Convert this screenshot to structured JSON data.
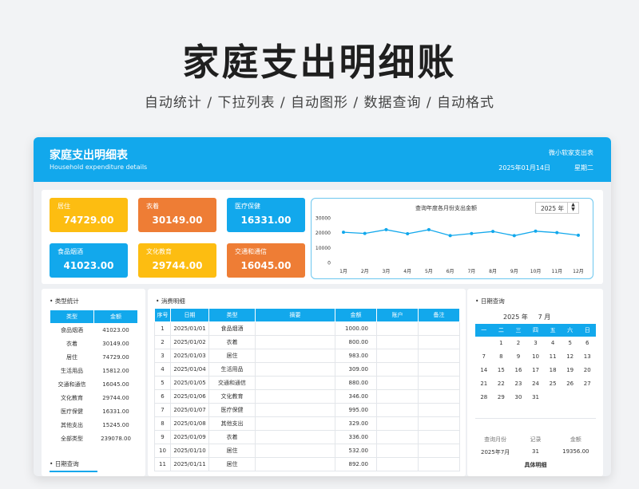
{
  "hero": {
    "title": "家庭支出明细账",
    "subtitle": "自动统计 / 下拉列表 / 自动图形 / 数据查询 / 自动格式"
  },
  "header": {
    "title": "家庭支出明细表",
    "subtitle": "Household expenditure details",
    "brand": "微小软家支出表",
    "date": "2025年01月14日",
    "weekday": "星期二"
  },
  "colors": {
    "accent": "#12a8ec",
    "yellow": "#fdbd11",
    "orange": "#ee7d35",
    "blue": "#12a8ec"
  },
  "cards": [
    {
      "label": "居住",
      "value": "74729.00",
      "color": "#fdbd11"
    },
    {
      "label": "衣着",
      "value": "30149.00",
      "color": "#ee7d35"
    },
    {
      "label": "医疗保健",
      "value": "16331.00",
      "color": "#12a8ec"
    },
    {
      "label": "食品烟酒",
      "value": "41023.00",
      "color": "#12a8ec"
    },
    {
      "label": "文化教育",
      "value": "29744.00",
      "color": "#fdbd11"
    },
    {
      "label": "交通和通信",
      "value": "16045.00",
      "color": "#ee7d35"
    }
  ],
  "chart": {
    "year": "2025 年",
    "spin_up": "▲",
    "spin_down": "▼"
  },
  "chart_data": {
    "type": "line",
    "title": "查询年度各月份支出金额",
    "categories": [
      "1月",
      "2月",
      "3月",
      "4月",
      "5月",
      "6月",
      "7月",
      "8月",
      "9月",
      "10月",
      "11月",
      "12月"
    ],
    "values": [
      20300,
      19500,
      22000,
      19300,
      22000,
      18000,
      19400,
      20800,
      18000,
      21000,
      20000,
      18300
    ],
    "ylim": [
      0,
      30000
    ],
    "yticks": [
      "30000",
      "20000",
      "10000",
      "0"
    ],
    "color": "#12a8ec"
  },
  "type_stats": {
    "title": "类型统计",
    "headers": [
      "类型",
      "金额"
    ],
    "rows": [
      [
        "食品烟酒",
        "41023.00"
      ],
      [
        "衣着",
        "30149.00"
      ],
      [
        "居住",
        "74729.00"
      ],
      [
        "生活用品",
        "15812.00"
      ],
      [
        "交通和通信",
        "16045.00"
      ],
      [
        "文化教育",
        "29744.00"
      ],
      [
        "医疗保健",
        "16331.00"
      ],
      [
        "其他支出",
        "15245.00"
      ],
      [
        "全部类型",
        "239078.00"
      ]
    ],
    "date_query": "日期查询"
  },
  "details": {
    "title": "消费明细",
    "headers": [
      "序号",
      "日期",
      "类型",
      "摘要",
      "金额",
      "账户",
      "备注"
    ],
    "rows": [
      [
        "1",
        "2025/01/01",
        "食品烟酒",
        "",
        "1000.00",
        "",
        ""
      ],
      [
        "2",
        "2025/01/02",
        "衣着",
        "",
        "800.00",
        "",
        ""
      ],
      [
        "3",
        "2025/01/03",
        "居住",
        "",
        "983.00",
        "",
        ""
      ],
      [
        "4",
        "2025/01/04",
        "生活用品",
        "",
        "309.00",
        "",
        ""
      ],
      [
        "5",
        "2025/01/05",
        "交通和通信",
        "",
        "880.00",
        "",
        ""
      ],
      [
        "6",
        "2025/01/06",
        "文化教育",
        "",
        "346.00",
        "",
        ""
      ],
      [
        "7",
        "2025/01/07",
        "医疗保健",
        "",
        "995.00",
        "",
        ""
      ],
      [
        "8",
        "2025/01/08",
        "其他支出",
        "",
        "329.00",
        "",
        ""
      ],
      [
        "9",
        "2025/01/09",
        "衣着",
        "",
        "336.00",
        "",
        ""
      ],
      [
        "10",
        "2025/01/10",
        "居住",
        "",
        "532.00",
        "",
        ""
      ],
      [
        "11",
        "2025/01/11",
        "居住",
        "",
        "892.00",
        "",
        ""
      ]
    ]
  },
  "calendar": {
    "title": "日期查询",
    "year": "2025 年",
    "month": "7 月",
    "weekdays": [
      "一",
      "二",
      "三",
      "四",
      "五",
      "六",
      "日"
    ],
    "weeks": [
      [
        "",
        "1",
        "2",
        "3",
        "4",
        "5",
        "6"
      ],
      [
        "7",
        "8",
        "9",
        "10",
        "11",
        "12",
        "13"
      ],
      [
        "14",
        "15",
        "16",
        "17",
        "18",
        "19",
        "20"
      ],
      [
        "21",
        "22",
        "23",
        "24",
        "25",
        "26",
        "27"
      ],
      [
        "28",
        "29",
        "30",
        "31",
        "",
        "",
        ""
      ]
    ],
    "summary_headers": [
      "查询月份",
      "记录",
      "金额"
    ],
    "summary_values": [
      "2025年7月",
      "31",
      "19356.00"
    ],
    "detail_label": "具体明细"
  }
}
